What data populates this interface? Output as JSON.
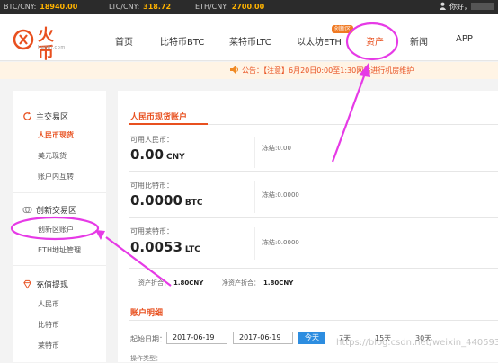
{
  "ticker": {
    "btc_label": "BTC/CNY:",
    "btc_value": "18940.00",
    "ltc_label": "LTC/CNY:",
    "ltc_value": "318.72",
    "eth_label": "ETH/CNY:",
    "eth_value": "2700.00",
    "greeting": "你好，"
  },
  "header": {
    "logo_text": "火币",
    "logo_sub": "huobi.com",
    "nav": [
      "首页",
      "比特币BTC",
      "莱特币LTC",
      "以太坊ETH",
      "资产",
      "新闻",
      "APP"
    ],
    "new_badge": "创新区",
    "active_nav": "资产"
  },
  "notice": {
    "text": "公告：【注意】6月20日0:00至1:30网站进行机房维护"
  },
  "sidebar": {
    "sections": [
      {
        "title": "主交易区",
        "items": [
          "人民币现货",
          "美元现货",
          "账户内互转"
        ]
      },
      {
        "title": "创新交易区",
        "items": [
          "创新区账户",
          "ETH地址管理"
        ]
      },
      {
        "title": "充值提现",
        "items": [
          "人民币",
          "比特币",
          "莱特币"
        ]
      }
    ],
    "active_item": "人民币现货"
  },
  "main": {
    "title": "人民币现货账户",
    "rows": [
      {
        "label": "可用人民币：",
        "amount": "0.00",
        "currency": "CNY",
        "frozen": "冻结:0.00"
      },
      {
        "label": "可用比特币：",
        "amount": "0.0000",
        "currency": "BTC",
        "frozen": "冻结:0.0000"
      },
      {
        "label": "可用莱特币：",
        "amount": "0.0053",
        "currency": "LTC",
        "frozen": "冻结:0.0000"
      }
    ],
    "asset_label": "资产折合：",
    "asset_value": "1.80CNY",
    "net_label": "净资产折合：",
    "net_value": "1.80CNY",
    "detail_title": "账户明细",
    "start_label": "起始日期：",
    "date_from": "2017-06-19",
    "date_to": "2017-06-19",
    "today_btn": "今天",
    "ranges": [
      "7天",
      "15天",
      "30天"
    ],
    "type_label": "操作类型："
  },
  "watermark": "https://blog.csdn.net/weixin_44059302",
  "colors": {
    "accent": "#e8501f",
    "annotation": "#e63ae6",
    "today": "#2d8de0"
  }
}
